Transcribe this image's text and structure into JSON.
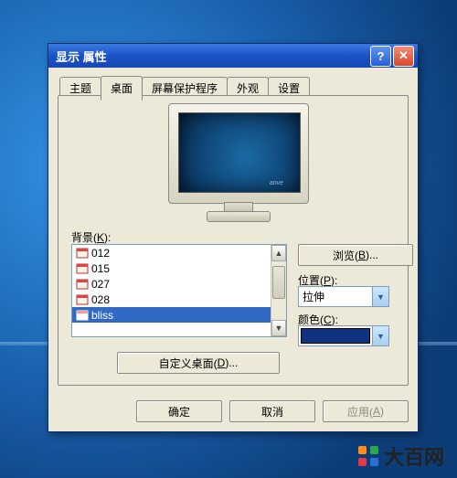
{
  "window": {
    "title": "显示 属性",
    "help": "?",
    "close": "✕"
  },
  "tabs": [
    "主题",
    "桌面",
    "屏幕保护程序",
    "外观",
    "设置"
  ],
  "activeTab": 1,
  "monitor": {
    "brand": "anve"
  },
  "background": {
    "label": "背景(K):",
    "items": [
      "012",
      "015",
      "027",
      "028",
      "bliss"
    ],
    "selectedIndex": 4
  },
  "browse": {
    "label": "浏览(B)..."
  },
  "position": {
    "label": "位置(P):",
    "value": "拉伸"
  },
  "color": {
    "label": "颜色(C):",
    "value": "#11327f"
  },
  "customize": {
    "label": "自定义桌面(D)..."
  },
  "buttons": {
    "ok": "确定",
    "cancel": "取消",
    "apply": "应用(A)"
  },
  "watermark": "大百网"
}
